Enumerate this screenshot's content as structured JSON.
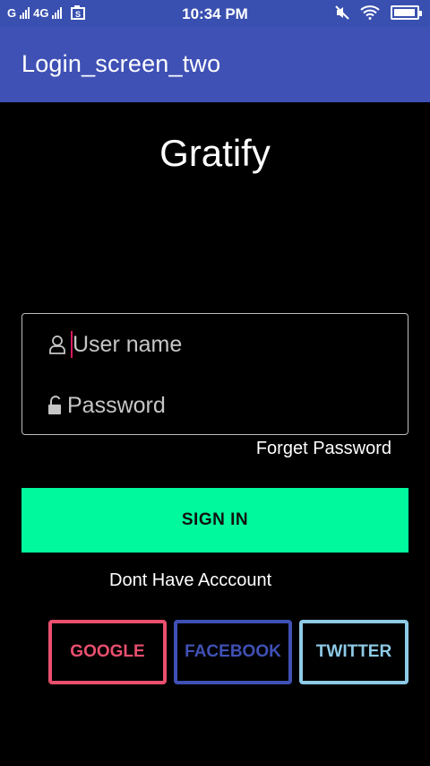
{
  "status_bar": {
    "left_text_1": "G",
    "left_text_2": "4G",
    "time": "10:34 PM",
    "icons": [
      "signal-icon",
      "sim-icon",
      "mute-icon",
      "wifi-icon",
      "battery-icon"
    ],
    "battery_level": 0.95
  },
  "app_bar": {
    "title": "Login_screen_two",
    "color": "#3f51b5"
  },
  "brand": {
    "title": "Gratify"
  },
  "form": {
    "username_placeholder": "User name",
    "password_placeholder": "Password",
    "forget_label": "Forget Password",
    "signin_label": "SIGN IN",
    "signin_color": "#00f99c",
    "no_account_label": "Dont Have Acccount"
  },
  "social": {
    "google": {
      "label": "GOOGLE",
      "color": "#e94f6e"
    },
    "facebook": {
      "label": "FACEBOOK",
      "color": "#3f51b5"
    },
    "twitter": {
      "label": "TWITTER",
      "color": "#8ecae6"
    }
  }
}
